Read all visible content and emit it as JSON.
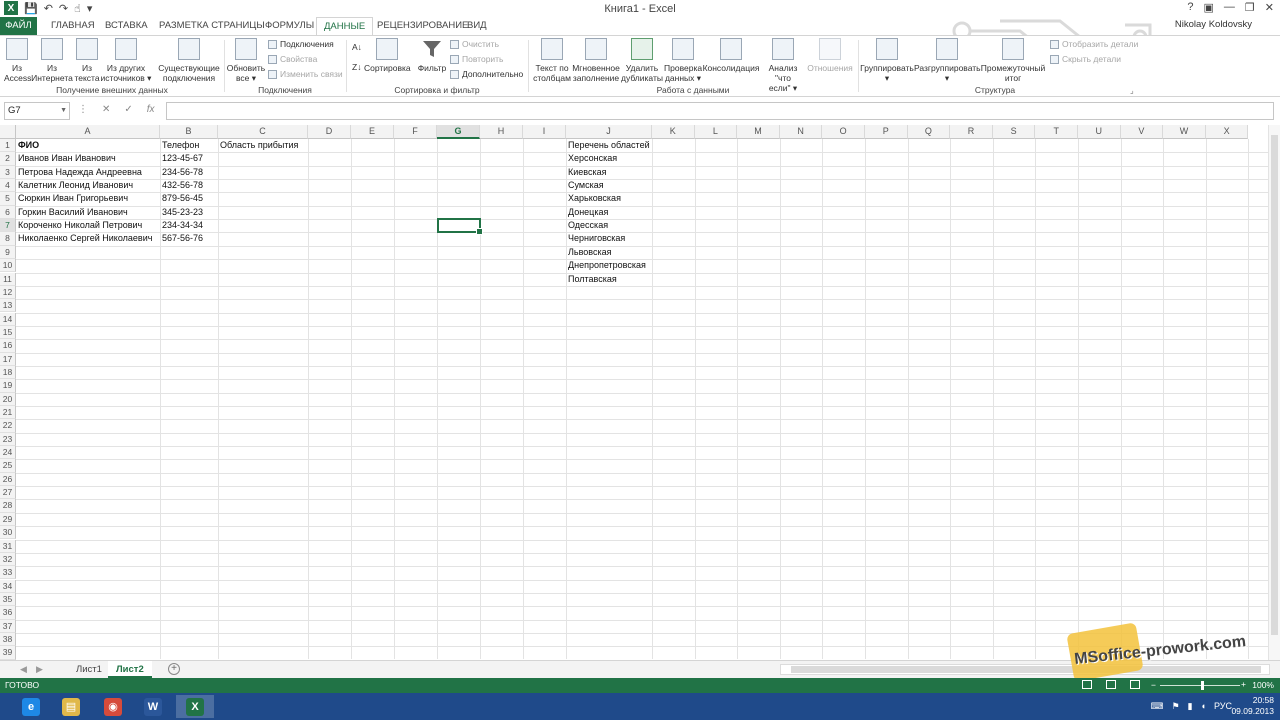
{
  "window": {
    "title": "Книга1 - Excel",
    "user": "Nikolay Koldovsky",
    "controls": [
      "?",
      "▣",
      "—",
      "❐",
      "✕"
    ]
  },
  "qat": {
    "app_logo": "X",
    "save": "💾",
    "undo": "↶",
    "redo": "↷",
    "touch": "☝",
    "customize": "▾"
  },
  "tabs": [
    {
      "label": "ФАЙЛ",
      "key": "file"
    },
    {
      "label": "ГЛАВНАЯ",
      "key": "home"
    },
    {
      "label": "ВСТАВКА",
      "key": "insert"
    },
    {
      "label": "РАЗМЕТКА СТРАНИЦЫ",
      "key": "layout"
    },
    {
      "label": "ФОРМУЛЫ",
      "key": "formulas"
    },
    {
      "label": "ДАННЫЕ",
      "key": "data",
      "active": true
    },
    {
      "label": "РЕЦЕНЗИРОВАНИЕ",
      "key": "review"
    },
    {
      "label": "ВИД",
      "key": "view"
    }
  ],
  "ribbon": {
    "external": {
      "group": "Получение внешних данных",
      "access": "Из\nAccess",
      "web": "Из\nИнтернета",
      "text": "Из\nтекста",
      "other": "Из других\nисточников ▾",
      "existing": "Существующие\nподключения"
    },
    "connections": {
      "group": "Подключения",
      "refresh": "Обновить\nвсе ▾",
      "connections": "Подключения",
      "properties": "Свойства",
      "edit_links": "Изменить связи"
    },
    "sort": {
      "group": "Сортировка и фильтр",
      "sort": "Сортировка",
      "filter": "Фильтр",
      "clear": "Очистить",
      "reapply": "Повторить",
      "advanced": "Дополнительно"
    },
    "tools": {
      "group": "Работа с данными",
      "text_to_columns": "Текст по\nстолбцам",
      "flash_fill": "Мгновенное\nзаполнение",
      "remove_dupes": "Удалить\nдубликаты",
      "validation": "Проверка\nданных ▾",
      "consolidate": "Консолидация",
      "whatif": "Анализ \"что\nесли\" ▾",
      "relationships": "Отношения"
    },
    "outline": {
      "group": "Структура",
      "group_btn": "Группировать\n▾",
      "ungroup_btn": "Разгруппировать\n▾",
      "subtotal": "Промежуточный\nитог",
      "show_detail": "Отобразить детали",
      "hide_detail": "Скрыть детали"
    }
  },
  "formula_bar": {
    "name_box": "G7",
    "cancel": "✕",
    "enter": "✓",
    "fx": "fx",
    "content": ""
  },
  "columns": [
    "A",
    "B",
    "C",
    "D",
    "E",
    "F",
    "G",
    "H",
    "I",
    "J",
    "K",
    "L",
    "M",
    "N",
    "O",
    "P",
    "Q",
    "R",
    "S",
    "T",
    "U",
    "V",
    "W",
    "X"
  ],
  "selected_column": "G",
  "selected_row": 7,
  "cells": [
    {
      "ref": "A1",
      "value": "ФИО",
      "bold": true
    },
    {
      "ref": "B1",
      "value": "Телефон"
    },
    {
      "ref": "C1",
      "value": "Область прибытия"
    },
    {
      "ref": "A2",
      "value": "Иванов Иван Иванович"
    },
    {
      "ref": "B2",
      "value": "123-45-67"
    },
    {
      "ref": "A3",
      "value": "Петрова Надежда Андреевна"
    },
    {
      "ref": "B3",
      "value": "234-56-78"
    },
    {
      "ref": "A4",
      "value": "Калетник Леонид Иванович"
    },
    {
      "ref": "B4",
      "value": "432-56-78"
    },
    {
      "ref": "A5",
      "value": "Сюркин Иван Григорьевич"
    },
    {
      "ref": "B5",
      "value": "879-56-45"
    },
    {
      "ref": "A6",
      "value": "Горкин Василий Иванович"
    },
    {
      "ref": "B6",
      "value": "345-23-23"
    },
    {
      "ref": "A7",
      "value": "Короченко Николай Петрович"
    },
    {
      "ref": "B7",
      "value": "234-34-34"
    },
    {
      "ref": "A8",
      "value": "Николаенко Сергей Николаевич"
    },
    {
      "ref": "B8",
      "value": "567-56-76"
    },
    {
      "ref": "J1",
      "value": "Перечень областей"
    },
    {
      "ref": "J2",
      "value": "Херсонская"
    },
    {
      "ref": "J3",
      "value": "Киевская"
    },
    {
      "ref": "J4",
      "value": "Сумская"
    },
    {
      "ref": "J5",
      "value": "Харьковская"
    },
    {
      "ref": "J6",
      "value": "Донецкая"
    },
    {
      "ref": "J7",
      "value": "Одесская"
    },
    {
      "ref": "J8",
      "value": "Черниговская"
    },
    {
      "ref": "J9",
      "value": "Львовская"
    },
    {
      "ref": "J10",
      "value": "Днепропетровская"
    },
    {
      "ref": "J11",
      "value": "Полтавская"
    }
  ],
  "row_count": 39,
  "sheets": [
    {
      "label": "Лист1"
    },
    {
      "label": "Лист2",
      "active": true
    }
  ],
  "sheet_nav": {
    "prev": "◀",
    "next": "▶",
    "add": "+"
  },
  "status": {
    "ready": "ГОТОВО",
    "zoom": "100%",
    "zoom_minus": "−",
    "zoom_plus": "+"
  },
  "watermark": {
    "text": "MSoffice-prowork.com"
  },
  "taskbar": {
    "apps": [
      {
        "name": "ie",
        "glyph": "e",
        "color": "#1e88e5"
      },
      {
        "name": "explorer",
        "glyph": "▤",
        "color": "#e0b84a"
      },
      {
        "name": "chrome",
        "glyph": "◉",
        "color": "#d64b3b"
      },
      {
        "name": "word",
        "glyph": "W",
        "color": "#2b579a"
      },
      {
        "name": "excel",
        "glyph": "X",
        "color": "#217346",
        "active": true
      }
    ],
    "lang": "РУС",
    "time": "20:58",
    "date": "09.09.2013"
  },
  "colors": {
    "accent": "#217346",
    "taskbar": "#1f4a8a"
  }
}
